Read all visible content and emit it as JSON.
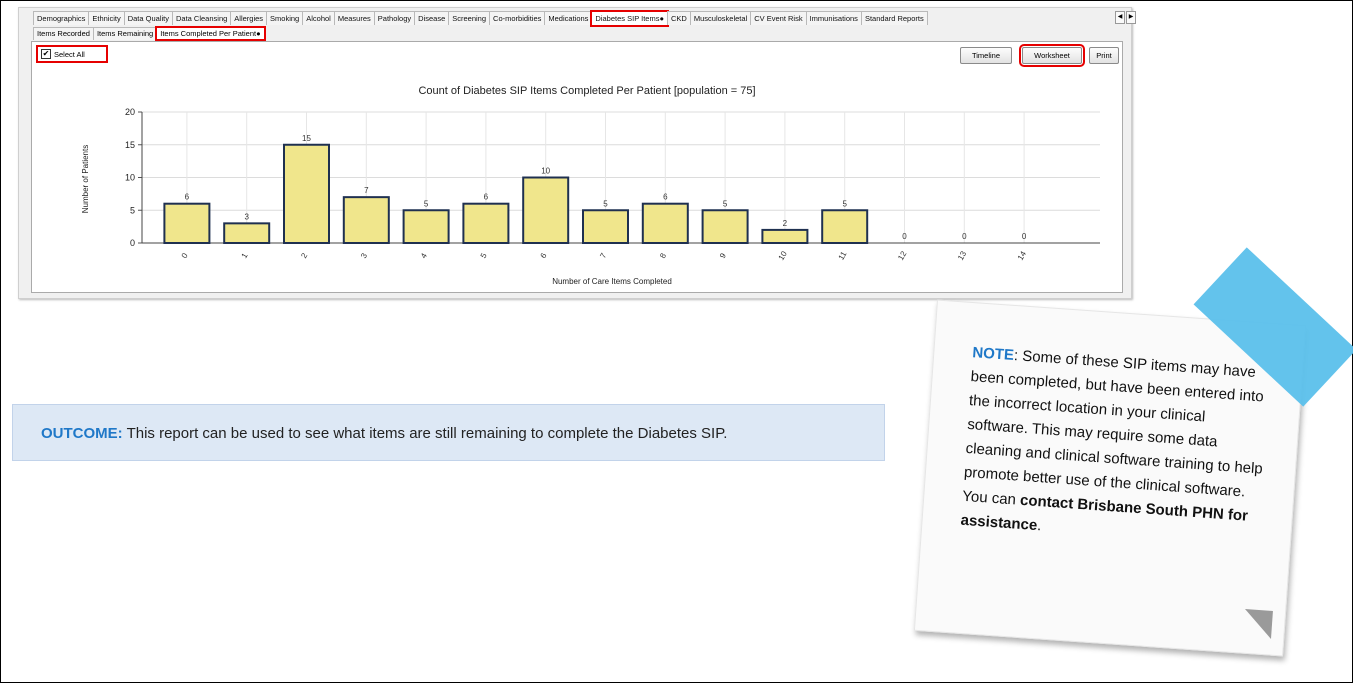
{
  "tabs": [
    "Demographics",
    "Ethnicity",
    "Data Quality",
    "Data Cleansing",
    "Allergies",
    "Smoking",
    "Alcohol",
    "Measures",
    "Pathology",
    "Disease",
    "Screening",
    "Co-morbidities",
    "Medications",
    "Diabetes SIP Items●",
    "CKD",
    "Musculoskeletal",
    "CV Event Risk",
    "Immunisations",
    "Standard Reports"
  ],
  "active_tab": "Diabetes SIP Items●",
  "subtabs": [
    "Items Recorded",
    "Items Remaining",
    "Items Completed Per Patient●"
  ],
  "select_all_label": "Select All",
  "select_all_checked": true,
  "buttons": {
    "timeline": "Timeline",
    "worksheet": "Worksheet",
    "print": "Print"
  },
  "chart_data": {
    "type": "bar",
    "title": "Count of Diabetes SIP Items Completed Per Patient [population = 75]",
    "xlabel": "Number of Care Items Completed",
    "ylabel": "Number of Patients",
    "categories": [
      "0",
      "1",
      "2",
      "3",
      "4",
      "5",
      "6",
      "7",
      "8",
      "9",
      "10",
      "11",
      "12",
      "13",
      "14"
    ],
    "values": [
      6,
      3,
      15,
      7,
      5,
      6,
      10,
      5,
      6,
      5,
      2,
      5,
      0,
      0,
      0
    ],
    "ylim": [
      0,
      20
    ],
    "yticks": [
      0,
      5,
      10,
      15,
      20
    ],
    "grid": true,
    "bar_color": "#f0e68c"
  },
  "outcome": {
    "keyword": "OUTCOME",
    "text": " This report can be used to see what items are still remaining to complete the Diabetes SIP."
  },
  "note": {
    "keyword": "NOTE",
    "text1": ": Some of these SIP items may have been completed, but have been entered into the incorrect location in your clinical software. This may require some data cleaning and clinical software training to help promote better use of the clinical software. You can ",
    "bold": "contact Brisbane South PHN for assistance",
    "text2": "."
  }
}
